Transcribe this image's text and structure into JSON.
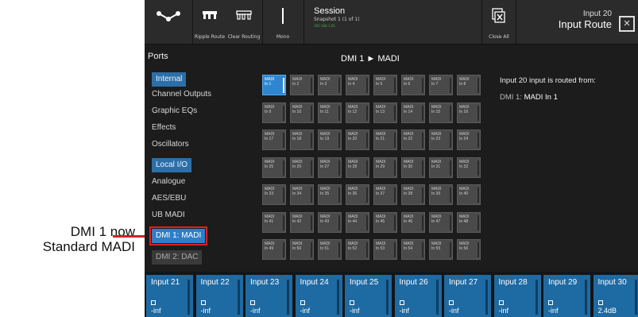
{
  "annotation": {
    "line1": "DMI 1 now",
    "line2": "Standard MADI"
  },
  "toolbar": {
    "ripple_label": "Ripple Route",
    "clear_label": "Clear Routing",
    "mono_label": "Mono",
    "session_title": "Session",
    "session_sub": "Snapshot 1 (1 of 1)",
    "session_ip": "192.168.1.65",
    "close_all_label": "Close All",
    "route_input": "Input 20",
    "route_title": "Input Route",
    "close_icon": "close-icon"
  },
  "ports": {
    "title": "Ports",
    "items": [
      {
        "label": "Internal",
        "type": "group"
      },
      {
        "label": "Channel Outputs",
        "type": "item"
      },
      {
        "label": "Graphic EQs",
        "type": "item"
      },
      {
        "label": "Effects",
        "type": "item"
      },
      {
        "label": "Oscillators",
        "type": "item"
      },
      {
        "label": "Local I/O",
        "type": "group"
      },
      {
        "label": "Analogue",
        "type": "item"
      },
      {
        "label": "AES/EBU",
        "type": "item"
      },
      {
        "label": "UB MADI",
        "type": "item"
      },
      {
        "label": "DMI 1: MADI",
        "type": "selected"
      },
      {
        "label": "DMI 2: DAC",
        "type": "disabled"
      }
    ]
  },
  "grid": {
    "title": "DMI 1 ► MADI",
    "cells": [
      "MADI In 1",
      "MADI In 2",
      "MADI In 3",
      "MADI In 4",
      "MADI In 5",
      "MADI In 6",
      "MADI In 7",
      "MADI In 8",
      "MADI In 9",
      "MADI In 10",
      "MADI In 11",
      "MADI In 12",
      "MADI In 13",
      "MADI In 14",
      "MADI In 15",
      "MADI In 16",
      "MADI In 17",
      "MADI In 18",
      "MADI In 19",
      "MADI In 20",
      "MADI In 21",
      "MADI In 22",
      "MADI In 23",
      "MADI In 24",
      "MADI In 25",
      "MADI In 26",
      "MADI In 27",
      "MADI In 28",
      "MADI In 29",
      "MADI In 30",
      "MADI In 31",
      "MADI In 32",
      "MADI In 33",
      "MADI In 34",
      "MADI In 35",
      "MADI In 36",
      "MADI In 37",
      "MADI In 38",
      "MADI In 39",
      "MADI In 40",
      "MADI In 41",
      "MADI In 42",
      "MADI In 43",
      "MADI In 44",
      "MADI In 45",
      "MADI In 46",
      "MADI In 47",
      "MADI In 48",
      "MADI In 49",
      "MADI In 50",
      "MADI In 51",
      "MADI In 52",
      "MADI In 53",
      "MADI In 54",
      "MADI In 55",
      "MADI In 56"
    ],
    "selected_index": 0
  },
  "info": {
    "text": "Input 20 input is routed from:",
    "source_label": "DMI 1:",
    "source_value": "MADI In 1"
  },
  "inputs": [
    {
      "name": "Input 21",
      "value": "-inf"
    },
    {
      "name": "Input 22",
      "value": "-inf"
    },
    {
      "name": "Input 23",
      "value": "-inf"
    },
    {
      "name": "Input 24",
      "value": "-inf"
    },
    {
      "name": "Input 25",
      "value": "-inf"
    },
    {
      "name": "Input 26",
      "value": "-inf"
    },
    {
      "name": "Input 27",
      "value": "-inf"
    },
    {
      "name": "Input 28",
      "value": "-inf"
    },
    {
      "name": "Input 29",
      "value": "-inf"
    },
    {
      "name": "Input 30",
      "value": "2.4dB"
    }
  ],
  "colors": {
    "accent": "#2d7ec8",
    "highlight": "#e02020"
  }
}
